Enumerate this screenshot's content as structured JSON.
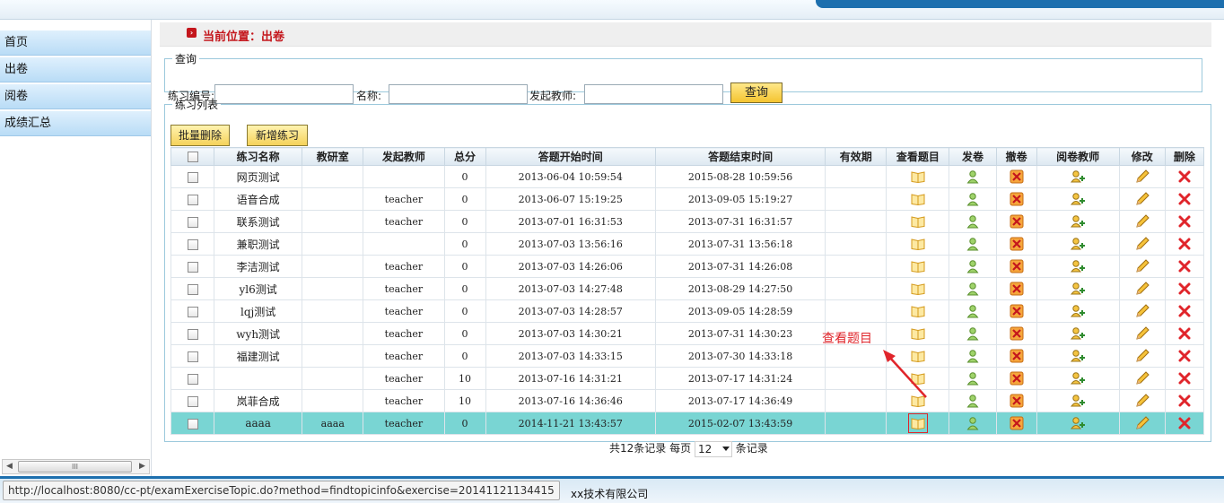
{
  "sidebar": {
    "items": [
      {
        "label": "首页"
      },
      {
        "label": "出卷"
      },
      {
        "label": "阅卷"
      },
      {
        "label": "成绩汇总"
      }
    ]
  },
  "breadcrumb": {
    "text": "当前位置：出卷"
  },
  "query": {
    "legend": "查询",
    "id_label": "练习编号:",
    "name_label": "名称:",
    "teacher_label": "发起教师:",
    "search_label": "查询"
  },
  "list": {
    "legend": "练习列表",
    "batch_delete_label": "批量删除",
    "add_label": "新增练习",
    "headers": [
      "练习名称",
      "教研室",
      "发起教师",
      "总分",
      "答题开始时间",
      "答题结束时间",
      "有效期",
      "查看题目",
      "发卷",
      "撤卷",
      "阅卷教师",
      "修改",
      "删除"
    ],
    "rows": [
      {
        "name": "网页测试",
        "room": "",
        "teacher": "",
        "score": "0",
        "start": "2013-06-04 10:59:54",
        "end": "2015-08-28 10:59:56",
        "valid": ""
      },
      {
        "name": "语音合成",
        "room": "",
        "teacher": "teacher",
        "score": "0",
        "start": "2013-06-07 15:19:25",
        "end": "2013-09-05 15:19:27",
        "valid": ""
      },
      {
        "name": "联系测试",
        "room": "",
        "teacher": "teacher",
        "score": "0",
        "start": "2013-07-01 16:31:53",
        "end": "2013-07-31 16:31:57",
        "valid": ""
      },
      {
        "name": "兼职测试",
        "room": "",
        "teacher": "",
        "score": "0",
        "start": "2013-07-03 13:56:16",
        "end": "2013-07-31 13:56:18",
        "valid": ""
      },
      {
        "name": "李洁测试",
        "room": "",
        "teacher": "teacher",
        "score": "0",
        "start": "2013-07-03 14:26:06",
        "end": "2013-07-31 14:26:08",
        "valid": ""
      },
      {
        "name": "yl6测试",
        "room": "",
        "teacher": "teacher",
        "score": "0",
        "start": "2013-07-03 14:27:48",
        "end": "2013-08-29 14:27:50",
        "valid": ""
      },
      {
        "name": "lqj测试",
        "room": "",
        "teacher": "teacher",
        "score": "0",
        "start": "2013-07-03 14:28:57",
        "end": "2013-09-05 14:28:59",
        "valid": ""
      },
      {
        "name": "wyh测试",
        "room": "",
        "teacher": "teacher",
        "score": "0",
        "start": "2013-07-03 14:30:21",
        "end": "2013-07-31 14:30:23",
        "valid": ""
      },
      {
        "name": "福建测试",
        "room": "",
        "teacher": "teacher",
        "score": "0",
        "start": "2013-07-03 14:33:15",
        "end": "2013-07-30 14:33:18",
        "valid": ""
      },
      {
        "name": "",
        "room": "",
        "teacher": "teacher",
        "score": "10",
        "start": "2013-07-16 14:31:21",
        "end": "2013-07-17 14:31:24",
        "valid": ""
      },
      {
        "name": "岚菲合成",
        "room": "",
        "teacher": "teacher",
        "score": "10",
        "start": "2013-07-16 14:36:46",
        "end": "2013-07-17 14:36:49",
        "valid": ""
      },
      {
        "name": "aaaa",
        "room": "aaaa",
        "teacher": "teacher",
        "score": "0",
        "start": "2014-11-21 13:43:57",
        "end": "2015-02-07 13:43:59",
        "valid": ""
      }
    ],
    "selected_row": 11,
    "colors": {
      "selected": "#79d5d3",
      "annotation": "#e0252b"
    }
  },
  "pager": {
    "total_text": "共12条记录",
    "per_page_label": "每页",
    "per_page_value": "12",
    "suffix": "条记录"
  },
  "annotation": {
    "text": "查看题目"
  },
  "footer": {
    "copyright": "xx技术有限公司"
  },
  "status": {
    "url": "http://localhost:8080/cc-pt/examExerciseTopic.do?method=findtopicinfo&exercise=20141121134415"
  },
  "sidebar_scroll": {
    "grip": "III"
  }
}
